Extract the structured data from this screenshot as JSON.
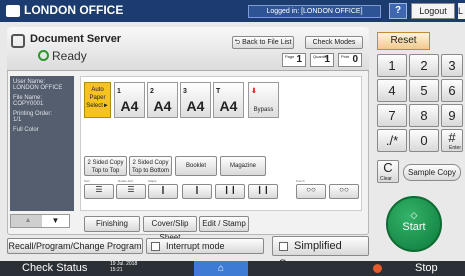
{
  "topbar": {
    "title": "LONDON OFFICE",
    "logged_in": "Logged in: [LONDON OFFICE]",
    "help": "?",
    "logout": "Logout",
    "edge": "L"
  },
  "header": {
    "title": "Document Server",
    "status": "Ready",
    "back_to_file_list": "Back to File List",
    "check_modes": "Check Modes",
    "counters": {
      "page_label": "Page",
      "page_value": "1",
      "quantity_label": "Quantity",
      "quantity_value": "1",
      "print_label": "Print",
      "print_value": "0"
    }
  },
  "info": {
    "user_name_label": "User Name:",
    "user_name": "LONDON OFFICE",
    "file_name_label": "File Name:",
    "file_name": "COPY0001",
    "print_order_label": "Printing Order:",
    "print_order": "1/1",
    "color": "Full Color"
  },
  "trays": {
    "auto_label": "Auto Paper Select►",
    "items": [
      {
        "n": "1",
        "size": "A4"
      },
      {
        "n": "2",
        "size": "A4"
      },
      {
        "n": "3",
        "size": "A4"
      },
      {
        "n": "T",
        "size": "A4"
      }
    ],
    "bypass": "Bypass"
  },
  "duplex": {
    "a": "2 Sided Copy Top to Top",
    "b": "2 Sided Copy Top to Bottom",
    "booklet": "Booklet",
    "magazine": "Magazine"
  },
  "small_labels": {
    "sort": "Sort",
    "rotate_sort": "Rotate Sort",
    "staple": "Staple",
    "punch": "Punch"
  },
  "tabs": {
    "finishing": "Finishing",
    "cover": "Cover/Slip Sheet",
    "edit": "Edit / Stamp"
  },
  "bottom": {
    "recall": "Recall/Program/Change Program",
    "interrupt": "Interrupt mode",
    "simplified": "Simplified Scrn."
  },
  "keypad": {
    "reset": "Reset",
    "keys": [
      "1",
      "2",
      "3",
      "4",
      "5",
      "6",
      "7",
      "8",
      "9",
      "./*",
      "0",
      "#"
    ],
    "enter": "Enter",
    "clear_key": "C",
    "clear_label": "Clear",
    "sample_copy": "Sample Copy",
    "start": "Start"
  },
  "footer": {
    "check_status": "Check Status",
    "date": "19 Jul. 2018",
    "time": "15:21",
    "stop": "Stop"
  },
  "colors": {
    "topbar": "#1c3b6e",
    "start": "#1a8a48",
    "reset": "#f1c98d",
    "tray_selected": "#f6c220"
  }
}
